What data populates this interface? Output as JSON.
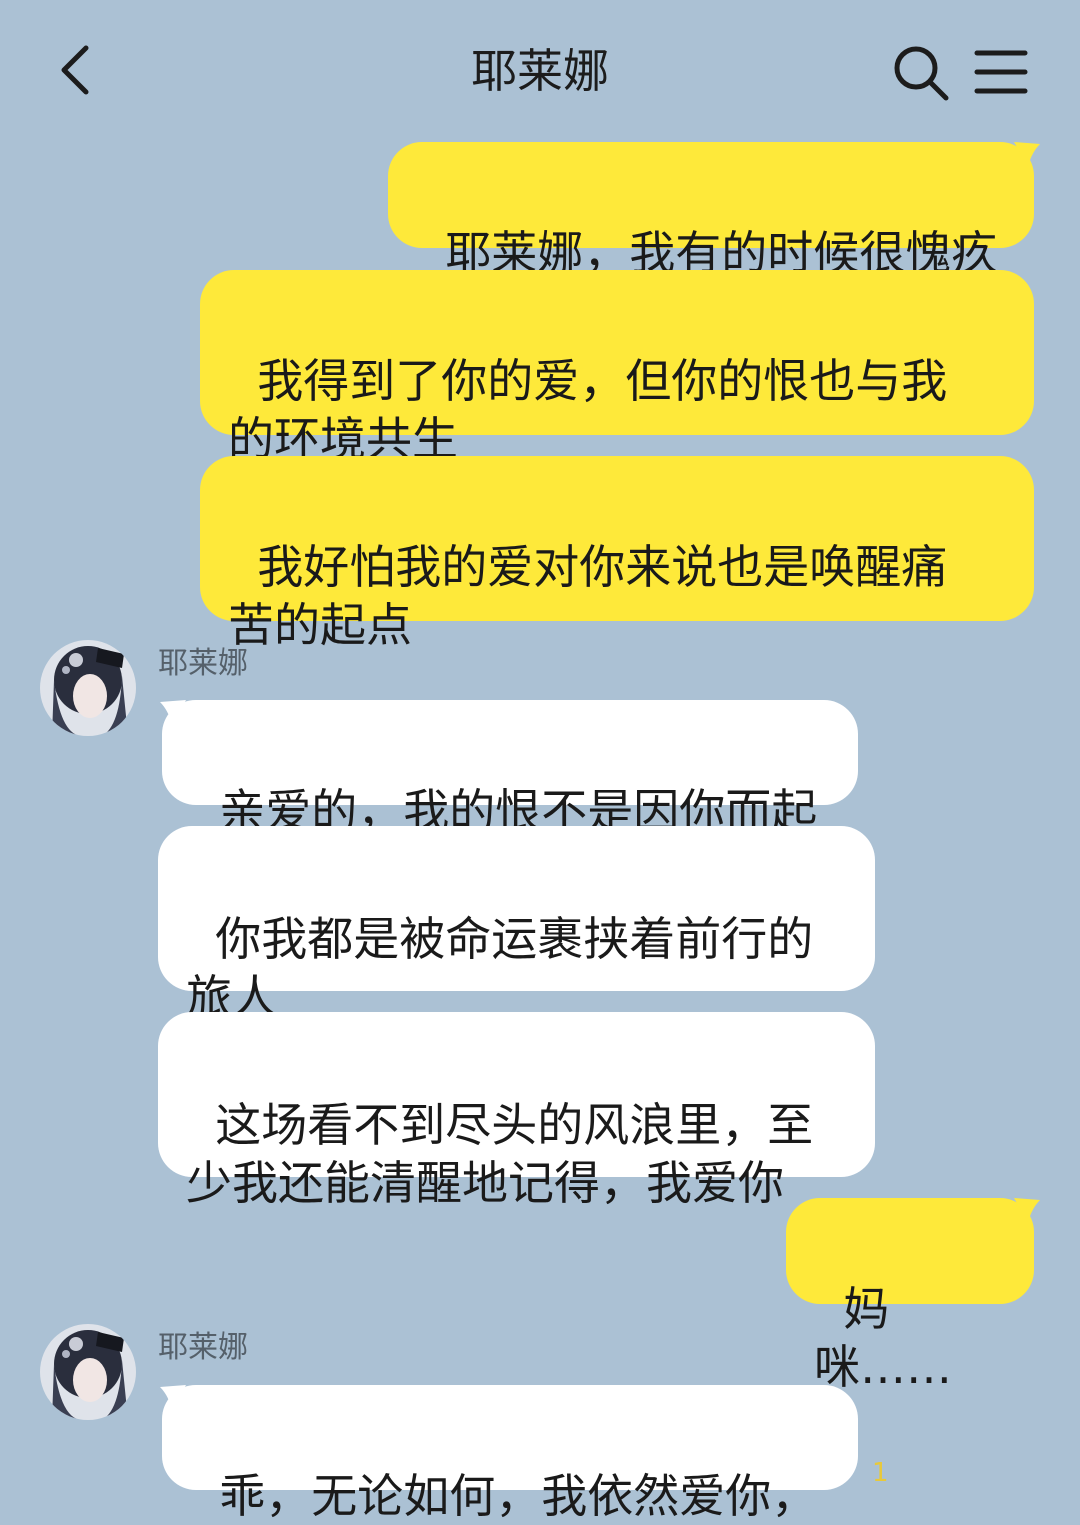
{
  "header": {
    "title": "耶莱娜",
    "back_icon": "chevron-left-icon",
    "search_icon": "search-icon",
    "menu_icon": "menu-icon"
  },
  "messages": [
    {
      "from": "me",
      "text": "耶莱娜，我有的时候很愧疚"
    },
    {
      "from": "me",
      "text": "我得到了你的爱，但你的恨也与我\n的环境共生"
    },
    {
      "from": "me",
      "text": "我好怕我的爱对你来说也是唤醒痛\n苦的起点"
    },
    {
      "from": "them",
      "sender": "耶莱娜",
      "text": "亲爱的，我的恨不是因你而起"
    },
    {
      "from": "them",
      "text": "你我都是被命运裹挟着前行的\n旅人"
    },
    {
      "from": "them",
      "text": "这场看不到尽头的风浪里，至\n少我还能清醒地记得，我爱你"
    },
    {
      "from": "me",
      "text": "妈咪……"
    },
    {
      "from": "them",
      "sender": "耶莱娜",
      "text": "乖，无论如何，我依然爱你，"
    }
  ],
  "unread_count": "1",
  "colors": {
    "background": "#abc1d4",
    "my_bubble": "#fee93a",
    "their_bubble": "#ffffff"
  }
}
